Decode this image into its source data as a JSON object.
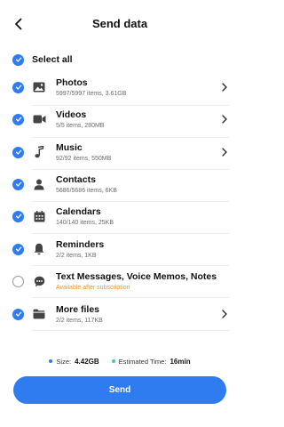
{
  "header": {
    "title": "Send data",
    "back_icon": "chevron-left-icon"
  },
  "select_all": {
    "label": "Select all",
    "checked": true
  },
  "colors": {
    "accent": "#2f7cf0",
    "warning": "#e69a2a",
    "time_dot": "#46c2c8"
  },
  "items": [
    {
      "name": "Photos",
      "sub": "5997/5997 items, 3.61GB",
      "icon": "photo-icon",
      "checked": true,
      "has_chevron": true
    },
    {
      "name": "Videos",
      "sub": "5/5 items, 280MB",
      "icon": "video-camera-icon",
      "checked": true,
      "has_chevron": true
    },
    {
      "name": "Music",
      "sub": "92/92 items, 550MB",
      "icon": "music-note-icon",
      "checked": true,
      "has_chevron": true
    },
    {
      "name": "Contacts",
      "sub": "5686/5686 items, 6KB",
      "icon": "person-icon",
      "checked": true,
      "has_chevron": false
    },
    {
      "name": "Calendars",
      "sub": "140/140 items, 25KB",
      "icon": "calendar-icon",
      "checked": true,
      "has_chevron": false
    },
    {
      "name": "Reminders",
      "sub": "2/2 items, 1KB",
      "icon": "bell-icon",
      "checked": true,
      "has_chevron": false
    },
    {
      "name": "Text Messages, Voice Memos, Notes",
      "sub": "Available after subscription",
      "icon": "chat-bubble-icon",
      "checked": false,
      "has_chevron": false
    },
    {
      "name": "More files",
      "sub": "2/2 items, 117KB",
      "icon": "folder-icon",
      "checked": true,
      "has_chevron": true
    }
  ],
  "summary": {
    "size_label": "Size:",
    "size_value": "4.42GB",
    "time_label": "Estimated Time:",
    "time_value": "16min"
  },
  "send_button": {
    "label": "Send"
  }
}
